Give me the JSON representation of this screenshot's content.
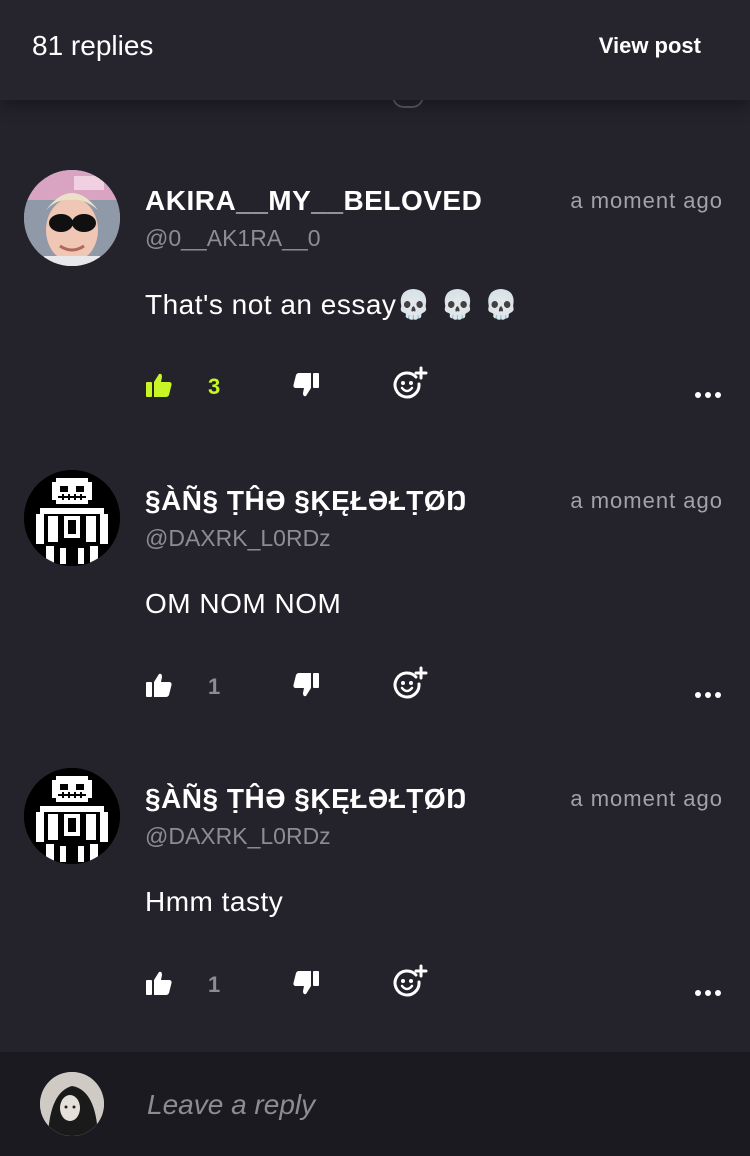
{
  "header": {
    "replies_label": "81 replies",
    "view_post_label": "View post"
  },
  "comments": [
    {
      "name": "AKIRA__MY__BELOVED",
      "handle": "@0__AK1RA__0",
      "timestamp": "a moment ago",
      "text": "That's not an essay💀 💀 💀",
      "likes": "3",
      "liked": true,
      "avatar_icon": "user-photo-avatar"
    },
    {
      "name": "§ÀÑ§ ṬĤƏ §ĶĘŁƏŁṬØŊ",
      "handle": "@DAXRK_L0RDz",
      "timestamp": "a moment ago",
      "text": "OM NOM NOM",
      "likes": "1",
      "liked": false,
      "avatar_icon": "pixel-skeleton-avatar"
    },
    {
      "name": "§ÀÑ§ ṬĤƏ §ĶĘŁƏŁṬØŊ",
      "handle": "@DAXRK_L0RDz",
      "timestamp": "a moment ago",
      "text": "Hmm tasty",
      "likes": "1",
      "liked": false,
      "avatar_icon": "pixel-skeleton-avatar"
    }
  ],
  "reply_bar": {
    "placeholder": "Leave a reply"
  },
  "colors": {
    "background": "#24232b",
    "accent_liked": "#c8f526",
    "muted_text": "#8d8c93"
  },
  "icons": {
    "like": "thumbs-up-icon",
    "dislike": "thumbs-down-icon",
    "react": "add-reaction-icon",
    "more": "more-dots-icon"
  }
}
